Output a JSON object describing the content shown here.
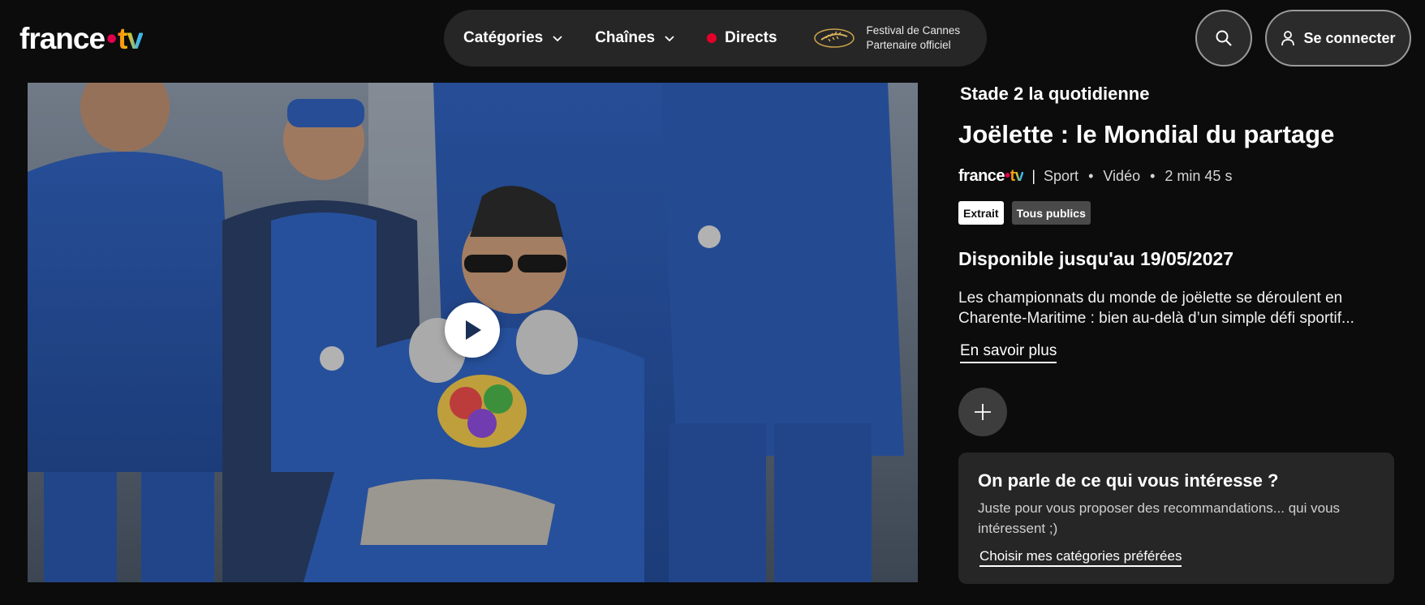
{
  "header": {
    "logo": {
      "main": "france",
      "dot": "•",
      "suffix": "tv"
    },
    "nav": [
      {
        "label": "Catégories",
        "icon": "chevron-down-icon"
      },
      {
        "label": "Chaînes",
        "icon": "chevron-down-icon"
      },
      {
        "label": "Directs",
        "icon": "live-dot-icon"
      }
    ],
    "partner": {
      "line1": "Festival de Cannes",
      "line2": "Partenaire officiel",
      "icon": "palme-icon"
    },
    "search_icon": "search-icon",
    "login_label": "Se connecter",
    "login_icon": "user-icon",
    "colors": {
      "live": "#e4002b",
      "brand_dot": "#e0004d"
    }
  },
  "video": {
    "play_icon": "play-icon"
  },
  "info": {
    "program_title": "Stade 2 la quotidienne",
    "episode_title": "Joëlette : le Mondial du partage",
    "channel_logo": {
      "main": "france",
      "dot": "•",
      "suffix": "tv"
    },
    "category": "Sport",
    "type": "Vidéo",
    "duration": "2 min 45 s",
    "tags": [
      "Extrait",
      "Tous publics"
    ],
    "availability": "Disponible jusqu'au 19/05/2027",
    "description": "Les championnats du monde de joëlette se déroulent en Charente-Maritime : bien au-delà d’un simple défi sportif...",
    "more_link": "En savoir plus",
    "add_icon": "plus-icon"
  },
  "reco": {
    "title": "On parle de ce qui vous intéresse ?",
    "text": "Juste pour vous proposer des recommandations... qui vous intéressent ;)",
    "link": "Choisir mes catégories préférées"
  }
}
